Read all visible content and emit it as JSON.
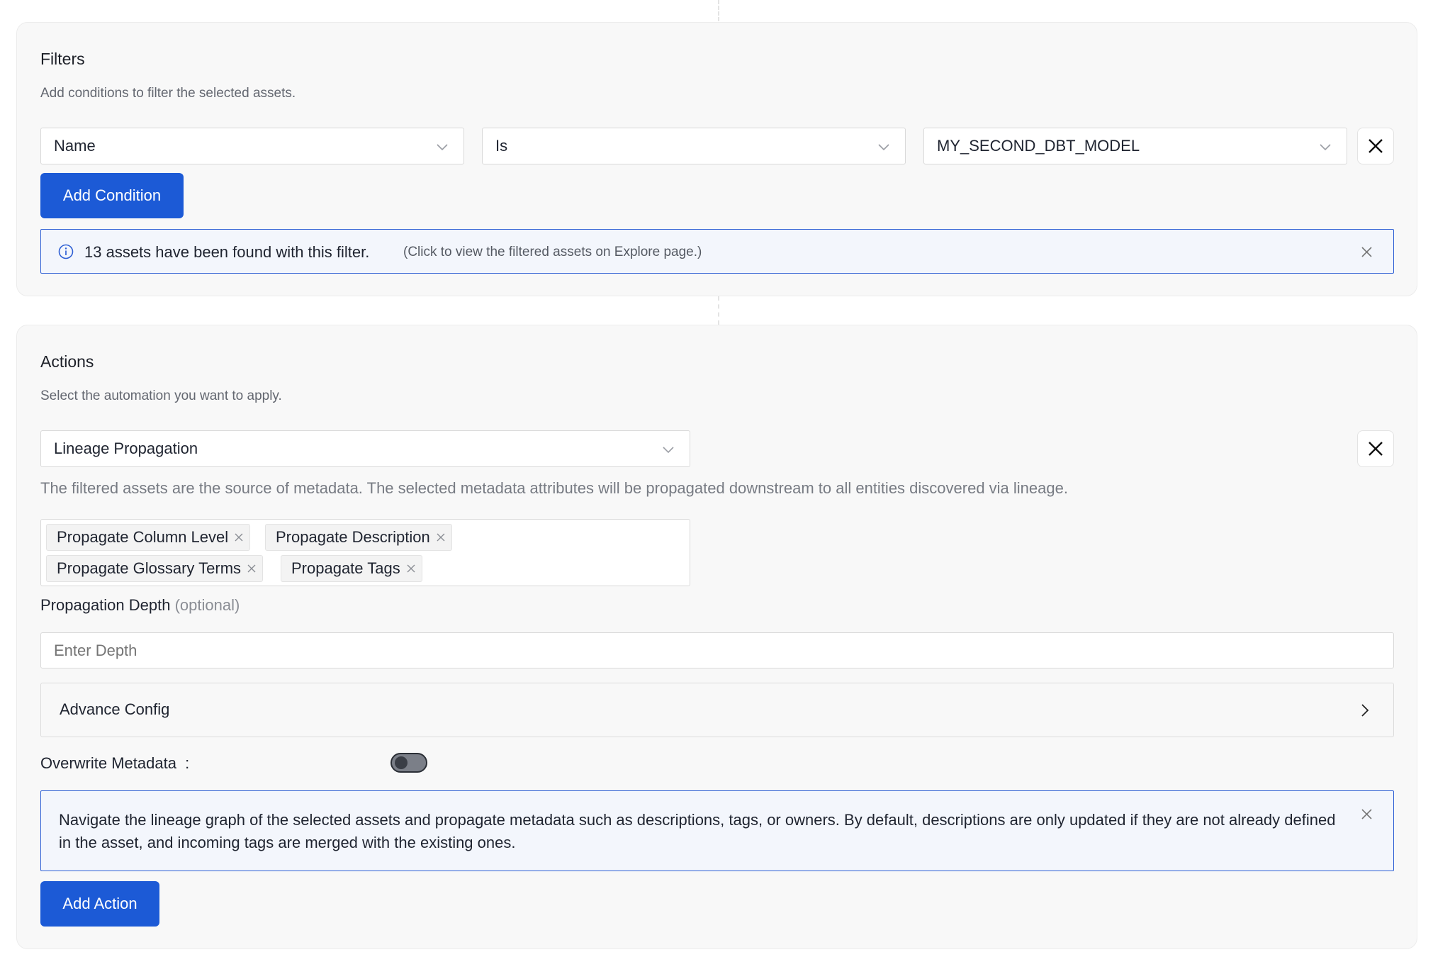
{
  "filters": {
    "title": "Filters",
    "subtitle": "Add conditions to filter the selected assets.",
    "condition": {
      "field": "Name",
      "operator": "Is",
      "value": "MY_SECOND_DBT_MODEL"
    },
    "add_condition_label": "Add Condition",
    "result_banner": {
      "message": "13 assets have been found with this filter.",
      "hint": "(Click to view the filtered assets on Explore page.)"
    }
  },
  "actions": {
    "title": "Actions",
    "subtitle": "Select the automation you want to apply.",
    "selected_action": "Lineage Propagation",
    "action_description": "The filtered assets are the source of metadata. The selected metadata attributes will be propagated downstream to all entities discovered via lineage.",
    "propagate_options": [
      "Propagate Column Level",
      "Propagate Description",
      "Propagate Glossary Terms",
      "Propagate Tags"
    ],
    "depth_label": "Propagation Depth",
    "depth_optional": "(optional)",
    "depth_placeholder": "Enter Depth",
    "advance_config_label": "Advance Config",
    "overwrite_label": "Overwrite Metadata",
    "overwrite_colon": ":",
    "overwrite_enabled": false,
    "info_text": "Navigate the lineage graph of the selected assets and propagate metadata such as descriptions, tags, or owners. By default, descriptions are only updated if they are not already defined in the asset, and incoming tags are merged with the existing ones.",
    "add_action_label": "Add Action"
  },
  "colors": {
    "primary": "#1c5ad6",
    "info_border": "#2e5fd4",
    "info_bg": "#f3f6fc",
    "card_bg": "#f8f8f8"
  }
}
